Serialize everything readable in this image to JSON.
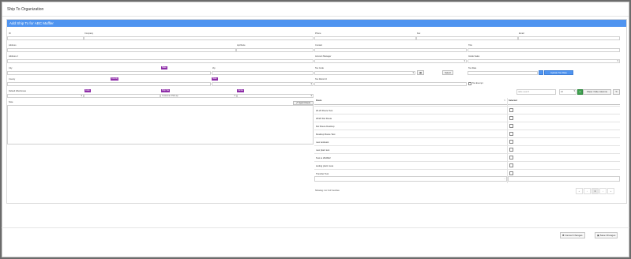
{
  "window": {
    "title": "Ship To Organization"
  },
  "panel": {
    "header": "Add Ship To for ABC Muffler"
  },
  "left": {
    "id": "ID",
    "company": "Company",
    "address": "Address",
    "apt_suite": "Apt/Suite",
    "address2": "Address 2",
    "city": "City",
    "zip": "Zip",
    "county": "County",
    "default_warehouse": "Default Warehouse",
    "note": "Note",
    "tags": {
      "state": "State",
      "country": "Country",
      "state2": "State",
      "code": "Code",
      "ship_via": "Ship Via",
      "carrier": "Carrier"
    },
    "ship_via_value": "Customer Pick-up",
    "spell_check": "Spell Check"
  },
  "right": {
    "phone": "Phone",
    "fax": "Fax",
    "email": "Email",
    "contact": "Contact",
    "title": "Title",
    "account_manager": "Account Manager",
    "inside_sales": "Inside Sales",
    "tax_code": "Tax Code",
    "tax_rate": "Tax Rate",
    "select_btn": "Select",
    "update_tax_btn": "Update Tax Rate",
    "tax_district": "Tax District #",
    "tax_exempt": "Tax Exempt"
  },
  "table_controls": {
    "search_placeholder": "table search",
    "page_size": "10",
    "show_hide": "Show / hide columns"
  },
  "routes_table": {
    "headers": {
      "route": "Route",
      "selected": "Selected"
    },
    "rows": [
      "20-20 Route Test",
      "20/20 Del Route",
      "Del Route Desktop",
      "Desktop Route Test",
      "new testtesst",
      "new plant test",
      "Test to WHS02",
      "testing plant route",
      "Transfer Test"
    ]
  },
  "pagination": {
    "info": "Showing 1 to 9 of 9 entries",
    "current_page": "1"
  },
  "footer": {
    "cancel": "Cancel Changes",
    "save": "Save Changes"
  }
}
